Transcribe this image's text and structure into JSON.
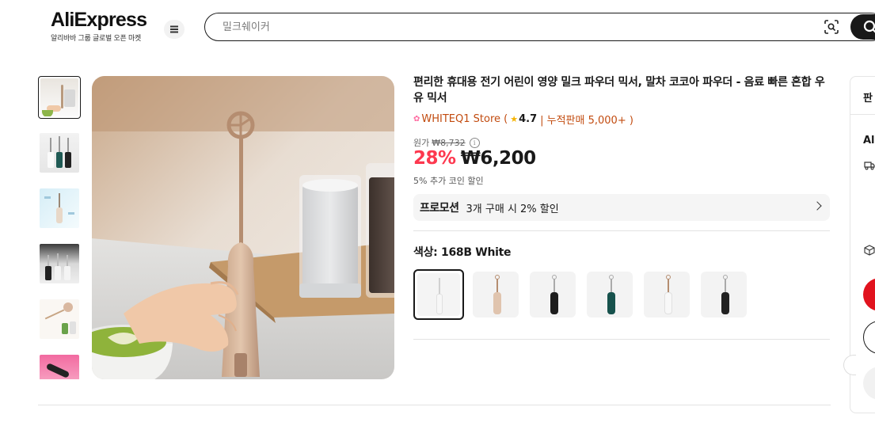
{
  "header": {
    "logo_text": "AliExpress",
    "logo_sub": "알리바바 그룹 글로벌 오픈 마켓",
    "search_placeholder": "밀크쉐이커",
    "menu_icon": "hamburger-menu-icon",
    "camera_icon": "image-search-icon",
    "search_icon": "search-icon"
  },
  "gallery": {
    "thumbnails": 6,
    "selected_index": 0
  },
  "product": {
    "title": "편리한 휴대용 전기 어린이 영양 밀크 파우더 믹서, 말차 코코아 파우더 - 음료 빠른 혼합 우유 믹서",
    "store_name": "WHITEQ1 Store (",
    "rating": "4.7",
    "sales": "| 누적판매 5,000+ )",
    "original_label": "원가",
    "original_price": "₩8,732",
    "discount": "28%",
    "price": "₩6,200",
    "coin_note": "5% 추가 코인 할인",
    "promo_title": "프로모션",
    "promo_text": "3개 구매 시 2% 할인",
    "color_label": "색상: 168B White"
  },
  "side_panel": {
    "title_partial": "판",
    "ship_partial": "Ali"
  },
  "colors": {
    "accent_red": "#fd384f",
    "store_orange": "#c24b0f",
    "button_red": "#e1131e"
  }
}
